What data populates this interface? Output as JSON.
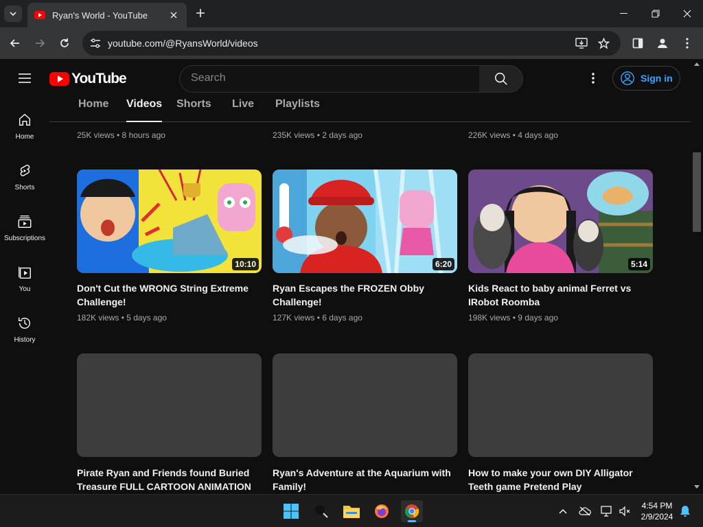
{
  "browser": {
    "tab_title": "Ryan's World - YouTube",
    "url": "youtube.com/@RyansWorld/videos"
  },
  "header": {
    "logo_text": "YouTube",
    "search_placeholder": "Search",
    "signin_label": "Sign in"
  },
  "guide": {
    "items": [
      {
        "label": "Home",
        "icon": "home-icon"
      },
      {
        "label": "Shorts",
        "icon": "shorts-icon"
      },
      {
        "label": "Subscriptions",
        "icon": "subscriptions-icon"
      },
      {
        "label": "You",
        "icon": "you-icon"
      },
      {
        "label": "History",
        "icon": "history-icon"
      }
    ]
  },
  "channel_tabs": [
    "Home",
    "Videos",
    "Shorts",
    "Live",
    "Playlists"
  ],
  "active_tab": "Videos",
  "partial_row": [
    {
      "meta": "25K views • 8 hours ago"
    },
    {
      "meta": "235K views • 2 days ago"
    },
    {
      "meta": "226K views • 4 days ago"
    }
  ],
  "videos": [
    {
      "title": "Don't Cut the WRONG String Extreme Challenge!",
      "meta": "182K views • 5 days ago",
      "duration": "10:10"
    },
    {
      "title": "Ryan Escapes the FROZEN Obby Challenge!",
      "meta": "127K views • 6 days ago",
      "duration": "6:20"
    },
    {
      "title": "Kids React to baby animal Ferret vs IRobot Roomba",
      "meta": "198K views • 9 days ago",
      "duration": "5:14"
    },
    {
      "title": "Pirate Ryan and Friends found Buried Treasure FULL CARTOON ANIMATION",
      "meta": "",
      "duration": ""
    },
    {
      "title": "Ryan's Adventure at the Aquarium with Family!",
      "meta": "",
      "duration": ""
    },
    {
      "title": "How to make your own DIY Alligator Teeth game Pretend Play",
      "meta": "",
      "duration": ""
    }
  ],
  "taskbar": {
    "time": "4:54 PM",
    "date": "2/9/2024"
  },
  "colors": {
    "youtube_red": "#ff0000",
    "link_blue": "#3ea6ff",
    "background": "#0f0f0f"
  }
}
